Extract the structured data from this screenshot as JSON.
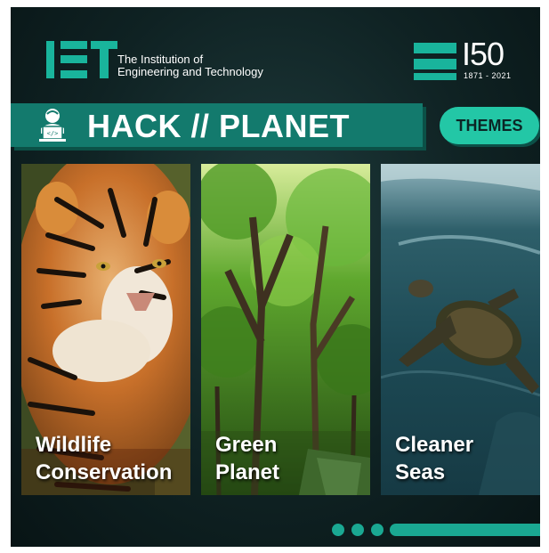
{
  "header": {
    "org_line1": "The Institution of",
    "org_line2": "Engineering and Technology",
    "anniversary_number": "I50",
    "anniversary_years": "1871 - 2021"
  },
  "banner": {
    "title": "HACK // PLANET",
    "icon": "hacker-laptop-icon"
  },
  "themes_button": {
    "label": "THEMES"
  },
  "cards": [
    {
      "line1": "Wildlife",
      "line2": "Conservation",
      "image": "tiger-photo"
    },
    {
      "line1": "Green",
      "line2": "Planet",
      "image": "forest-photo"
    },
    {
      "line1": "Cleaner",
      "line2": "Seas",
      "image": "sea-turtle-photo"
    }
  ],
  "colors": {
    "accent": "#19b49c",
    "banner": "#137a6d",
    "button": "#23c7a6",
    "background": "#0f2223"
  }
}
